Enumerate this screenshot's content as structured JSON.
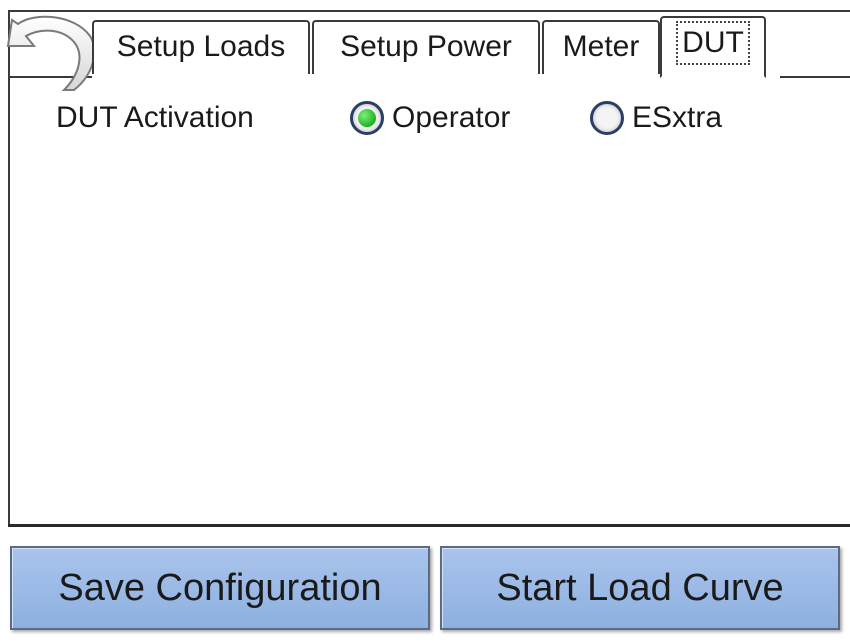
{
  "tabs": [
    {
      "label": "Setup Loads",
      "active": false
    },
    {
      "label": "Setup Power",
      "active": false
    },
    {
      "label": "Meter",
      "active": false
    },
    {
      "label": "DUT",
      "active": true
    }
  ],
  "dut_activation": {
    "label": "DUT Activation",
    "options": [
      {
        "label": "Operator",
        "selected": true
      },
      {
        "label": "ESxtra",
        "selected": false
      }
    ]
  },
  "actions": {
    "save_label": "Save Configuration",
    "start_label": "Start Load Curve"
  },
  "colors": {
    "button_fill": "#97b7e6",
    "radio_selected": "#1db31d",
    "radio_border": "#2b3f66"
  },
  "icons": {
    "back": "back-arrow-icon"
  }
}
